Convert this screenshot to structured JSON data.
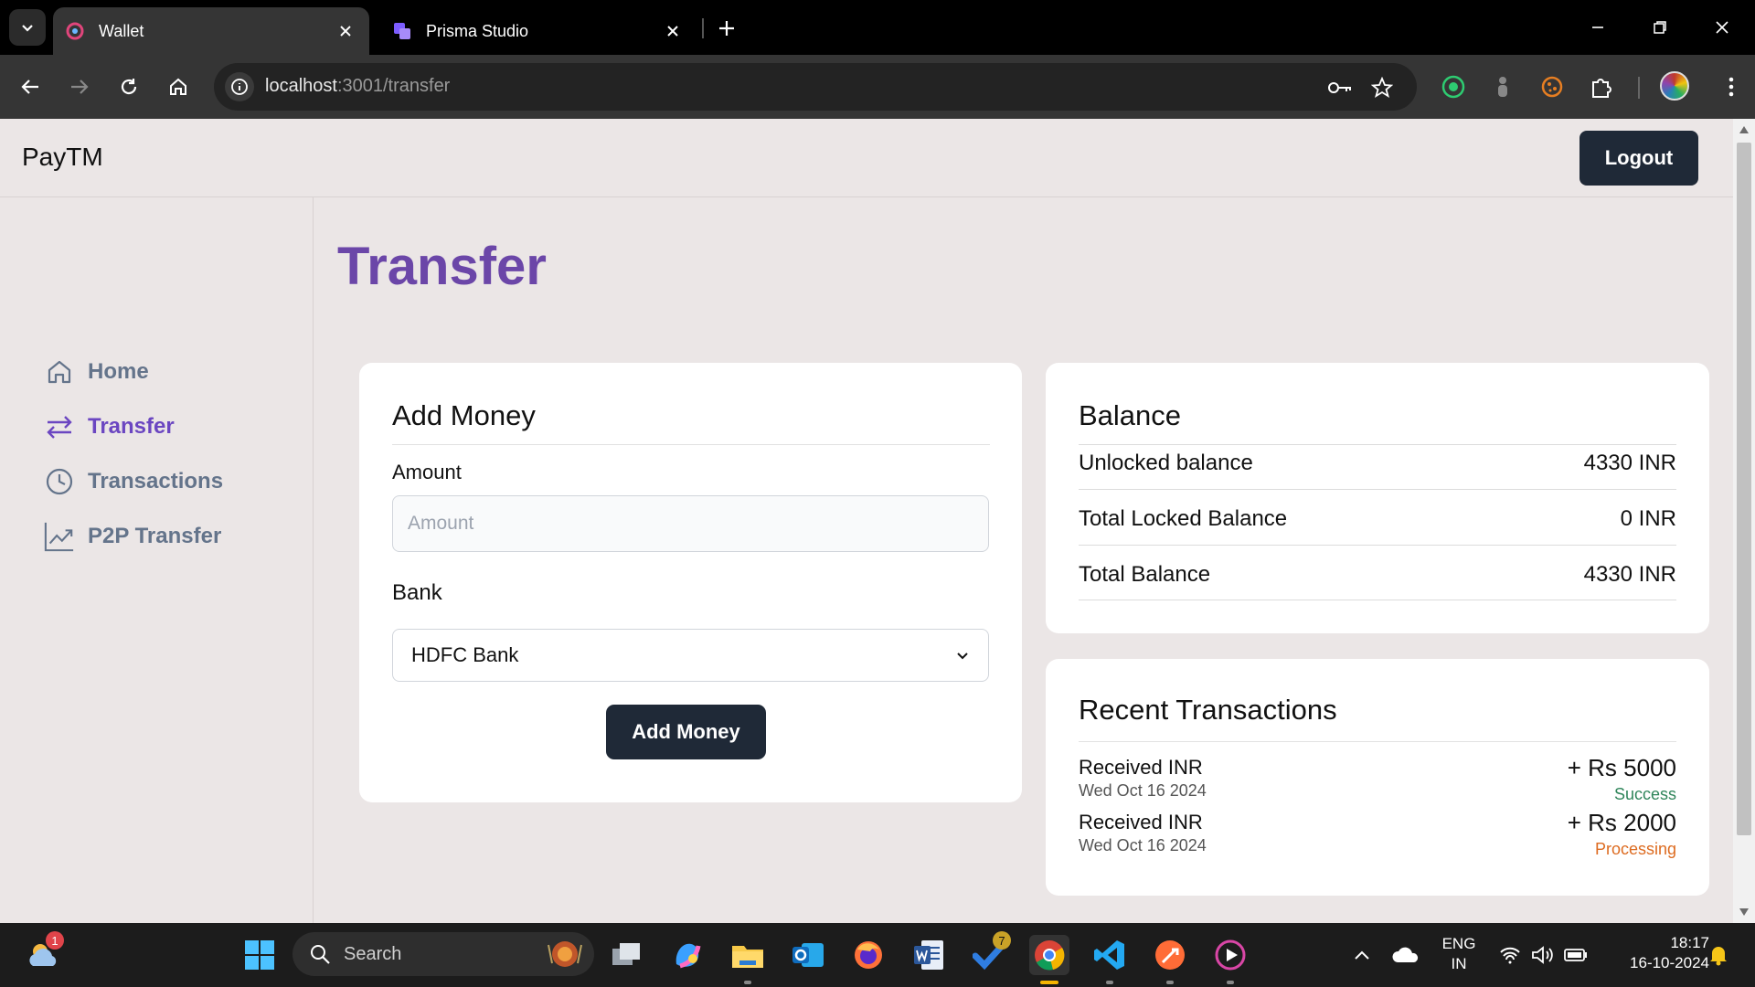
{
  "browser": {
    "tabs": [
      {
        "title": "Wallet",
        "active": true
      },
      {
        "title": "Prisma Studio",
        "active": false
      }
    ],
    "url": {
      "host": "localhost",
      "rest": ":3001/transfer"
    }
  },
  "app": {
    "brand": "PayTM",
    "logout_label": "Logout",
    "sidebar": [
      {
        "label": "Home",
        "icon": "home-icon",
        "active": false
      },
      {
        "label": "Transfer",
        "icon": "transfer-arrows-icon",
        "active": true
      },
      {
        "label": "Transactions",
        "icon": "clock-icon",
        "active": false
      },
      {
        "label": "P2P Transfer",
        "icon": "trend-chart-icon",
        "active": false
      }
    ],
    "page_title": "Transfer",
    "add_money": {
      "title": "Add Money",
      "amount_label": "Amount",
      "amount_placeholder": "Amount",
      "amount_value": "",
      "bank_label": "Bank",
      "bank_selected": "HDFC Bank",
      "button_label": "Add Money"
    },
    "balance": {
      "title": "Balance",
      "rows": [
        {
          "label": "Unlocked balance",
          "value": "4330 INR"
        },
        {
          "label": "Total Locked Balance",
          "value": "0 INR"
        },
        {
          "label": "Total Balance",
          "value": "4330 INR"
        }
      ]
    },
    "recent": {
      "title": "Recent Transactions",
      "items": [
        {
          "name": "Received INR",
          "date": "Wed Oct 16 2024",
          "amount": "+ Rs 5000",
          "status": "Success",
          "status_color": "#2f855a"
        },
        {
          "name": "Received INR",
          "date": "Wed Oct 16 2024",
          "amount": "+ Rs 2000",
          "status": "Processing",
          "status_color": "#dd6b20"
        }
      ]
    },
    "colors": {
      "accent": "#6b46c1",
      "dark_button": "#1f2937",
      "page_bg": "#ebe6e6"
    }
  },
  "taskbar": {
    "search_label": "Search",
    "weather_badge": "1",
    "todo_badge": "7",
    "lang_top": "ENG",
    "lang_bottom": "IN",
    "time": "18:17",
    "date": "16-10-2024"
  }
}
